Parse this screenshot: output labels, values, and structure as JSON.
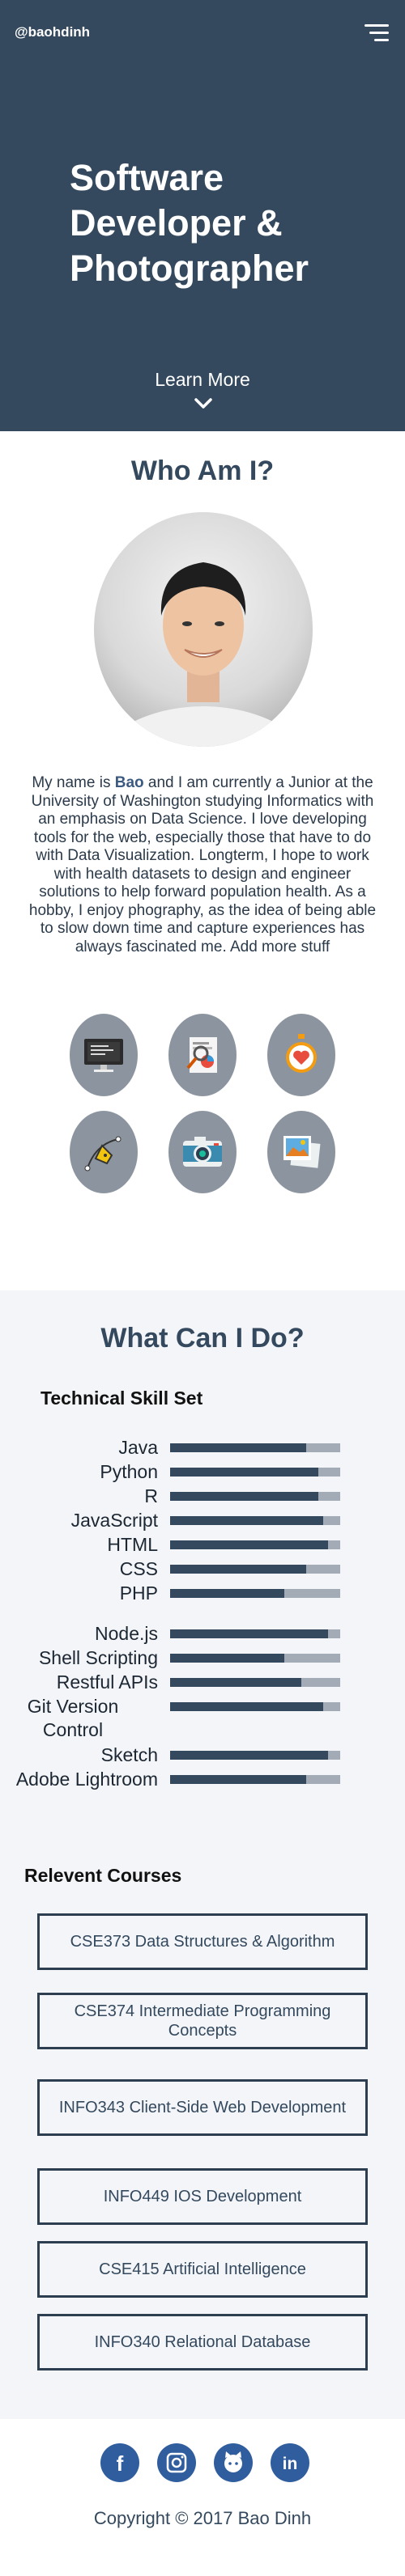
{
  "header": {
    "brand": "@baohdinh",
    "menu_icon": "hamburger-menu-icon"
  },
  "hero": {
    "title_line1": "Software",
    "title_line2": "Developer &",
    "title_line3": "Photographer",
    "learn_more": "Learn More",
    "chevron_icon": "chevron-down-icon"
  },
  "about": {
    "title": "Who Am I?",
    "bio_before": "My name is ",
    "bio_name": "Bao",
    "bio_after": " and I am currently a Junior at the University of Washington studying Informatics with an emphasis on Data Science. I love developing tools for the web, especially those that have to do with Data Visualization. Longterm, I hope to work with health datasets to design and engineer solutions to help forward population health. As a hobby, I enjoy phography, as the idea of being able to slow down time and capture experiences has always fascinated me. Add more stuff",
    "icons": [
      "computer-icon",
      "data-report-icon",
      "heart-stopwatch-icon",
      "pen-tool-icon",
      "camera-icon",
      "photos-icon"
    ]
  },
  "skills": {
    "title": "What Can I Do?",
    "technical_title": "Technical Skill Set",
    "items": [
      {
        "name": "Java",
        "level": 0.8
      },
      {
        "name": "Python",
        "level": 0.87
      },
      {
        "name": "R",
        "level": 0.87
      },
      {
        "name": "JavaScript",
        "level": 0.9
      },
      {
        "name": "HTML",
        "level": 0.93
      },
      {
        "name": "CSS",
        "level": 0.8
      },
      {
        "name": "PHP",
        "level": 0.67
      },
      {
        "name": "Node.js",
        "level": 0.93
      },
      {
        "name": "Shell Scripting",
        "level": 0.67
      },
      {
        "name": "Restful APIs",
        "level": 0.77
      },
      {
        "name": "Git Version Control",
        "level": 0.9
      },
      {
        "name": "Sketch",
        "level": 0.93
      },
      {
        "name": "Adobe Lightroom",
        "level": 0.8
      }
    ],
    "courses_title": "Relevent Courses",
    "courses": [
      "CSE373 Data Structures & Algorithm",
      "CSE374 Intermediate Programming Concepts",
      "INFO343 Client-Side Web Development",
      "INFO449 IOS Development",
      "CSE415 Artificial Intelligence",
      "INFO340 Relational Database"
    ]
  },
  "footer": {
    "social": [
      {
        "icon": "facebook-icon",
        "glyph": "f"
      },
      {
        "icon": "instagram-icon",
        "glyph": ""
      },
      {
        "icon": "github-icon",
        "glyph": ""
      },
      {
        "icon": "linkedin-icon",
        "glyph": "in"
      }
    ],
    "copyright": "Copyright © 2017 Bao Dinh"
  },
  "colors": {
    "primary": "#34495e",
    "bar_track": "#a3abb6",
    "icon_bg": "#8c959f",
    "social_bg": "#2f5d9e",
    "section_alt_bg": "#f3f5f8"
  }
}
